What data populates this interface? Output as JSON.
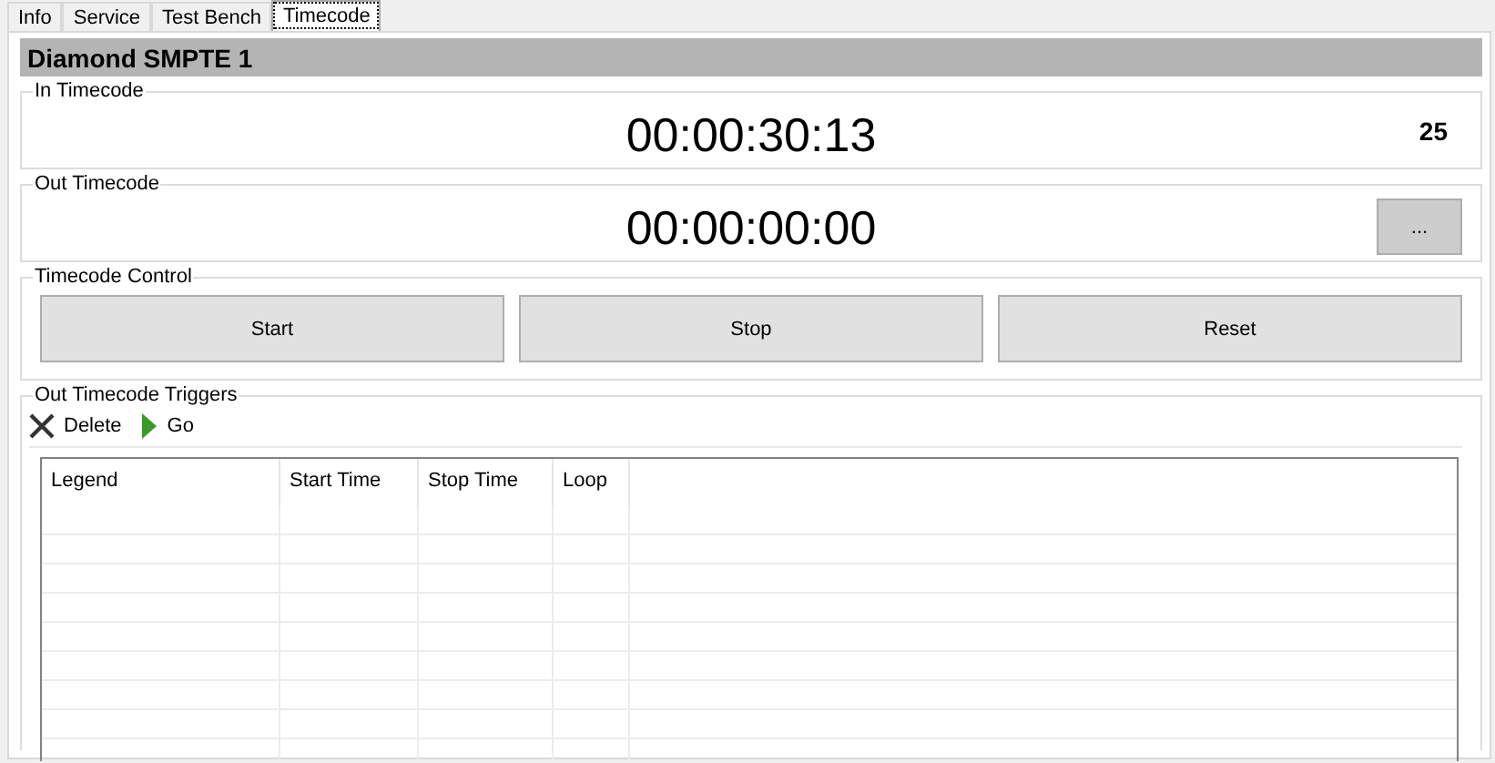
{
  "tabs": [
    {
      "label": "Info",
      "selected": false
    },
    {
      "label": "Service",
      "selected": false
    },
    {
      "label": "Test Bench",
      "selected": false
    },
    {
      "label": "Timecode",
      "selected": true
    }
  ],
  "device_title": "Diamond SMPTE 1",
  "in_timecode": {
    "label": "In Timecode",
    "value": "00:00:30:13",
    "frame_rate": "25"
  },
  "out_timecode": {
    "label": "Out Timecode",
    "value": "00:00:00:00",
    "button": "..."
  },
  "timecode_control": {
    "label": "Timecode Control",
    "buttons": [
      "Start",
      "Stop",
      "Reset"
    ]
  },
  "triggers": {
    "label": "Out Timecode Triggers",
    "toolbar": [
      {
        "kind": "delete",
        "label": "Delete"
      },
      {
        "kind": "go",
        "label": "Go"
      }
    ],
    "columns": [
      "Legend",
      "Start Time",
      "Stop Time",
      "Loop"
    ]
  }
}
